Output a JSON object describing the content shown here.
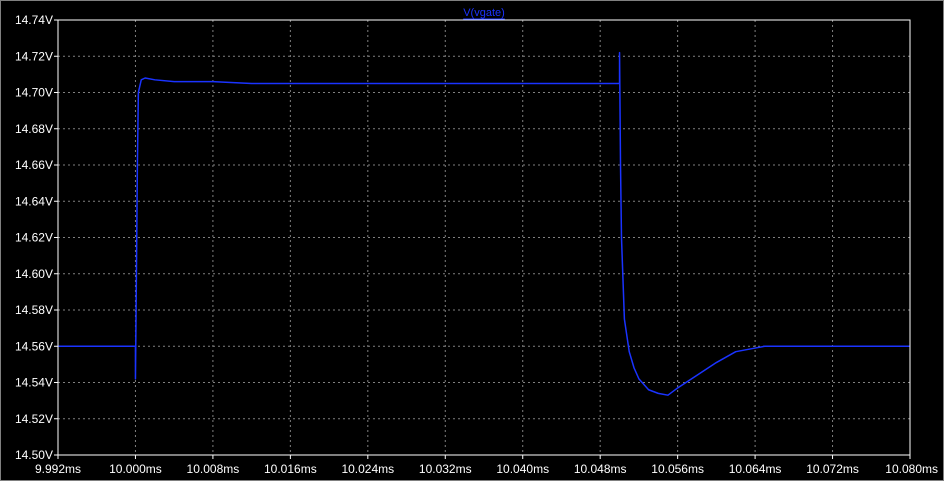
{
  "chart_data": {
    "type": "line",
    "title": "",
    "xlabel": "",
    "ylabel": "",
    "x_unit": "ms",
    "y_unit": "V",
    "xlim": [
      9.992,
      10.08
    ],
    "ylim": [
      14.5,
      14.74
    ],
    "x_ticks": [
      9.992,
      10.0,
      10.008,
      10.016,
      10.024,
      10.032,
      10.04,
      10.048,
      10.056,
      10.064,
      10.072,
      10.08
    ],
    "x_tick_labels": [
      "9.992ms",
      "10.000ms",
      "10.008ms",
      "10.016ms",
      "10.024ms",
      "10.032ms",
      "10.040ms",
      "10.048ms",
      "10.056ms",
      "10.064ms",
      "10.072ms",
      "10.080ms"
    ],
    "y_ticks": [
      14.5,
      14.52,
      14.54,
      14.56,
      14.58,
      14.6,
      14.62,
      14.64,
      14.66,
      14.68,
      14.7,
      14.72,
      14.74
    ],
    "y_tick_labels": [
      "14.50V",
      "14.52V",
      "14.54V",
      "14.56V",
      "14.58V",
      "14.60V",
      "14.62V",
      "14.64V",
      "14.66V",
      "14.68V",
      "14.70V",
      "14.72V",
      "14.74V"
    ],
    "grid": true,
    "grid_style": "dotted",
    "background": "#000000",
    "axes_color": "#ffffff",
    "grid_color": "#808080",
    "series": [
      {
        "name": "V(vgate)",
        "color": "#1a33ff",
        "x": [
          9.992,
          10.0,
          10.0,
          10.0001,
          10.0002,
          10.0003,
          10.0006,
          10.001,
          10.002,
          10.004,
          10.008,
          10.012,
          10.02,
          10.03,
          10.04,
          10.05,
          10.05,
          10.0501,
          10.0502,
          10.0505,
          10.051,
          10.0515,
          10.052,
          10.053,
          10.054,
          10.055,
          10.056,
          10.058,
          10.06,
          10.062,
          10.064,
          10.065,
          10.07,
          10.08
        ],
        "y": [
          14.56,
          14.56,
          14.542,
          14.6,
          14.66,
          14.7,
          14.707,
          14.708,
          14.707,
          14.706,
          14.706,
          14.705,
          14.705,
          14.705,
          14.705,
          14.705,
          14.722,
          14.66,
          14.62,
          14.575,
          14.557,
          14.548,
          14.542,
          14.536,
          14.534,
          14.533,
          14.537,
          14.544,
          14.551,
          14.557,
          14.559,
          14.56,
          14.56,
          14.56
        ]
      }
    ]
  }
}
